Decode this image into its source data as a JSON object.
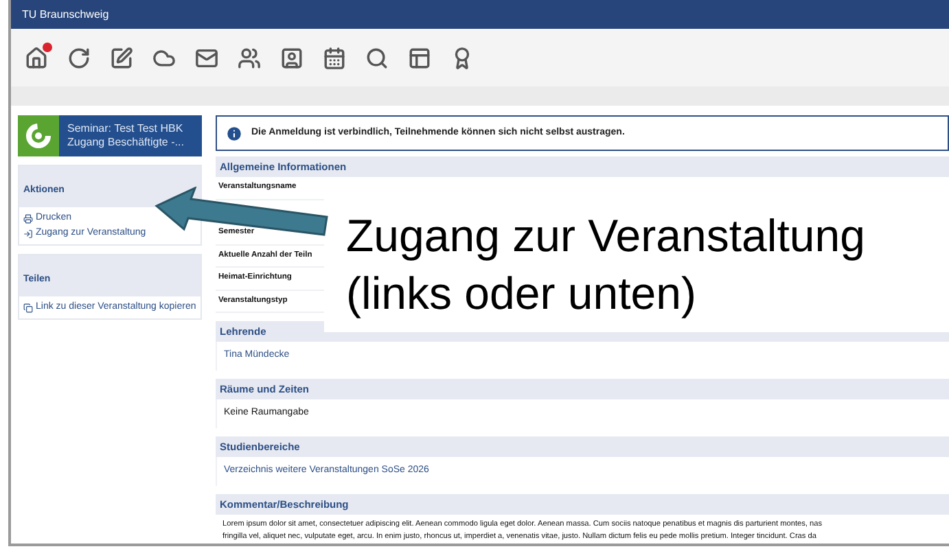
{
  "header": {
    "title": "TU Braunschweig"
  },
  "course": {
    "title": "Seminar: Test Test HBK",
    "subtitle": "Zugang Beschäftigte -..."
  },
  "sidebar": [
    {
      "title": "Aktionen",
      "items": [
        {
          "label": "Drucken"
        },
        {
          "label": "Zugang zur Veranstaltung"
        }
      ]
    },
    {
      "title": "Teilen",
      "items": [
        {
          "label": "Link zu dieser Veranstaltung kopieren"
        }
      ]
    }
  ],
  "notice": "Die Anmeldung ist verbindlich, Teilnehmende können sich nicht selbst austragen.",
  "general_info": {
    "title": "Allgemeine Informationen",
    "rows": [
      "Veranstaltungsname",
      "",
      "Semester",
      "Aktuelle Anzahl der Teiln",
      "Heimat-Einrichtung",
      "Veranstaltungstyp"
    ]
  },
  "sections": [
    {
      "title": "Lehrende",
      "text": "Tina Mündecke",
      "kind": "link"
    },
    {
      "title": "Räume und Zeiten",
      "text": "Keine Raumangabe",
      "kind": "plain"
    },
    {
      "title": "Studienbereiche",
      "text": "Verzeichnis weitere Veranstaltungen SoSe 2026",
      "kind": "link"
    }
  ],
  "description": {
    "title": "Kommentar/Beschreibung",
    "lines": [
      "Lorem ipsum dolor sit amet, consectetuer adipiscing elit. Aenean commodo ligula eget dolor. Aenean massa. Cum sociis natoque penatibus et magnis dis parturient montes, nas",
      "fringilla vel, aliquet nec, vulputate eget, arcu. In enim justo, rhoncus ut, imperdiet a, venenatis vitae, justo. Nullam dictum felis eu pede mollis pretium. Integer tincidunt. Cras da"
    ]
  },
  "annotation": {
    "lines": [
      "Zugang zur Veranstaltung",
      "(links oder unten)"
    ]
  }
}
